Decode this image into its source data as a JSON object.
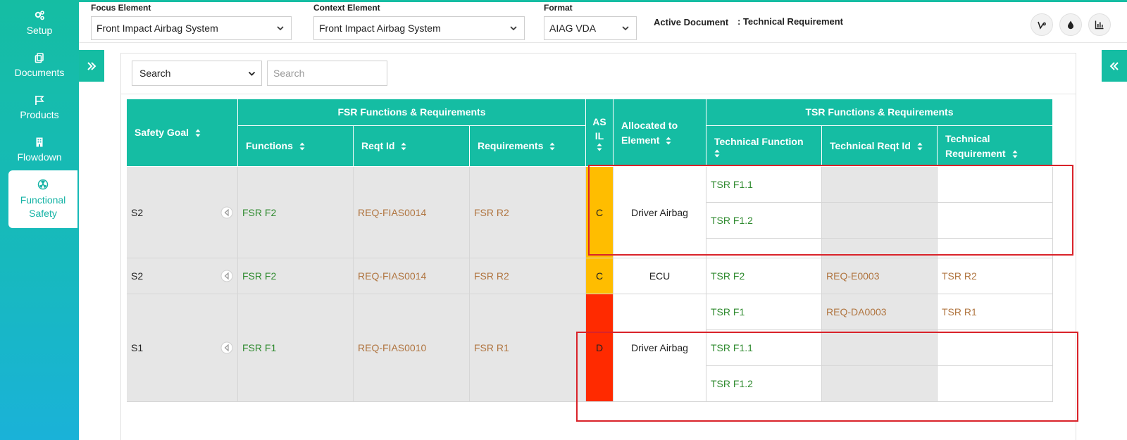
{
  "sidebar": {
    "items": [
      {
        "label": "Setup",
        "icon": "gears-icon"
      },
      {
        "label": "Documents",
        "icon": "copy-icon"
      },
      {
        "label": "Products",
        "icon": "flag-icon"
      },
      {
        "label": "Flowdown",
        "icon": "building-icon"
      },
      {
        "label": "Functional Safety",
        "icon": "radiation-icon",
        "active": true
      }
    ]
  },
  "topbar": {
    "focus_label": "Focus Element",
    "focus_value": "Front Impact Airbag System",
    "context_label": "Context Element",
    "context_value": "Front Impact Airbag System",
    "format_label": "Format",
    "format_value": "AIAG VDA",
    "active_doc_label": "Active Document",
    "active_doc_value": ": Technical Requirement",
    "buttons": [
      "vine-icon",
      "droplet-icon",
      "bar-chart-icon"
    ]
  },
  "filters": {
    "column_select": "Search",
    "search_placeholder": "Search"
  },
  "table": {
    "headers": {
      "safety_goal": "Safety Goal",
      "fsr_group": "FSR Functions & Requirements",
      "functions": "Functions",
      "reqt_id": "Reqt Id",
      "requirements": "Requirements",
      "asil_1": "AS",
      "asil_2": "IL",
      "allocated_1": "Allocated to",
      "allocated_2": "Element",
      "tsr_group": "TSR Functions & Requirements",
      "tech_function": "Technical Function",
      "tech_reqt_id": "Technical Reqt Id",
      "tech_req_1": "Technical",
      "tech_req_2": "Requirement"
    },
    "rows": [
      {
        "safety_goal": "S2",
        "function": "FSR F2",
        "reqt_id": "REQ-FIAS0014",
        "requirement": "FSR R2",
        "asil": "C",
        "allocated": "Driver Airbag",
        "tsr": [
          {
            "function": "TSR F1.1",
            "reqt_id": "",
            "requirement": ""
          },
          {
            "function": "TSR F1.2",
            "reqt_id": "",
            "requirement": ""
          }
        ]
      },
      {
        "safety_goal": "S2",
        "function": "FSR F2",
        "reqt_id": "REQ-FIAS0014",
        "requirement": "FSR R2",
        "asil": "C",
        "allocated": "ECU",
        "tsr": [
          {
            "function": "TSR F2",
            "reqt_id": "REQ-E0003",
            "requirement": "TSR R2"
          }
        ]
      },
      {
        "safety_goal": "S1",
        "function": "FSR F1",
        "reqt_id": "REQ-FIAS0010",
        "requirement": "FSR R1",
        "asil": "D",
        "allocated": "Driver Airbag",
        "tsr": [
          {
            "function": "TSR F1",
            "reqt_id": "REQ-DA0003",
            "requirement": "TSR R1"
          },
          {
            "function": "TSR F1.1",
            "reqt_id": "",
            "requirement": ""
          },
          {
            "function": "TSR F1.2",
            "reqt_id": "",
            "requirement": ""
          }
        ]
      }
    ]
  },
  "colors": {
    "accent": "#15bda3",
    "asil_c": "#ffbd00",
    "asil_d": "#ff2a00",
    "link_green": "#2e8a2e",
    "link_brown": "#b07540",
    "highlight": "#d9232a"
  }
}
